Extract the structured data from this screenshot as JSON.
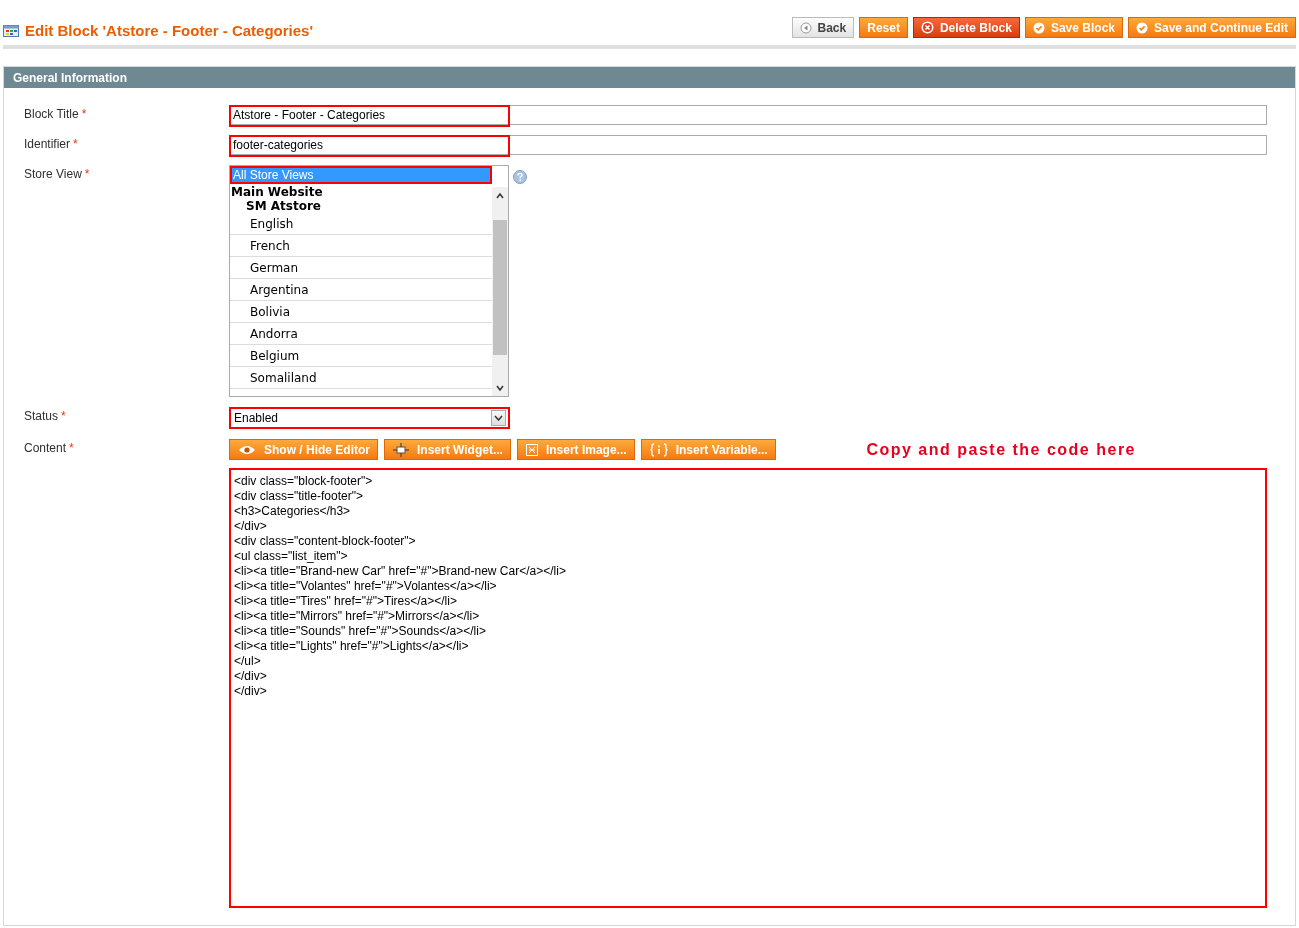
{
  "header": {
    "title": "Edit Block 'Atstore - Footer - Categories'",
    "buttons": [
      {
        "kind": "back",
        "label": "Back"
      },
      {
        "kind": "plain",
        "label": "Reset"
      },
      {
        "kind": "delete",
        "label": "Delete Block"
      },
      {
        "kind": "save",
        "label": "Save Block"
      },
      {
        "kind": "save",
        "label": "Save and Continue Edit"
      }
    ]
  },
  "section": {
    "title": "General Information"
  },
  "fields": [
    {
      "kind": "text",
      "label": "Block Title",
      "required_mark": "*",
      "value": "Atstore - Footer - Categories",
      "highlighted": true
    },
    {
      "kind": "text",
      "label": "Identifier",
      "required_mark": "*",
      "value": "footer-categories",
      "highlighted": true
    },
    {
      "kind": "multiselect",
      "label": "Store View",
      "required_mark": "*",
      "highlighted": true,
      "options": [
        {
          "kind": "option",
          "label": "All Store Views",
          "selected": true
        },
        {
          "kind": "group",
          "label": "Main Website"
        },
        {
          "kind": "subgroup",
          "label": "SM Atstore"
        },
        {
          "kind": "option",
          "label": "English",
          "selected": false
        },
        {
          "kind": "option",
          "label": "French",
          "selected": false
        },
        {
          "kind": "option",
          "label": "German",
          "selected": false
        },
        {
          "kind": "option",
          "label": "Argentina",
          "selected": false
        },
        {
          "kind": "option",
          "label": "Bolivia",
          "selected": false
        },
        {
          "kind": "option",
          "label": "Andorra",
          "selected": false
        },
        {
          "kind": "option",
          "label": "Belgium",
          "selected": false
        },
        {
          "kind": "option",
          "label": "Somaliland",
          "selected": false
        }
      ]
    },
    {
      "kind": "select",
      "label": "Status",
      "required_mark": "*",
      "value": "Enabled",
      "highlighted": true
    },
    {
      "kind": "editor",
      "label": "Content",
      "required_mark": "*",
      "highlighted": true,
      "note": "Copy and paste the code here",
      "buttons": [
        {
          "kind": "eye",
          "label": "Show / Hide Editor"
        },
        {
          "kind": "widget",
          "label": "Insert Widget..."
        },
        {
          "kind": "image",
          "label": "Insert Image..."
        },
        {
          "kind": "variable",
          "label": "Insert Variable..."
        }
      ],
      "lines": [
        "<div class=\"block-footer\">",
        "<div class=\"title-footer\">",
        "<h3>Categories</h3>",
        "</div>",
        "<div class=\"content-block-footer\">",
        "<ul class=\"list_item\">",
        "<li><a title=\"Brand-new Car\" href=\"#\">Brand-new Car</a></li>",
        "<li><a title=\"Volantes\" href=\"#\">Volantes</a></li>",
        "<li><a title=\"Tires\" href=\"#\">Tires</a></li>",
        "<li><a title=\"Mirrors\" href=\"#\">Mirrors</a></li>",
        "<li><a title=\"Sounds\" href=\"#\">Sounds</a></li>",
        "<li><a title=\"Lights\" href=\"#\">Lights</a></li>",
        "</ul>",
        "</div>",
        "</div>"
      ]
    }
  ]
}
